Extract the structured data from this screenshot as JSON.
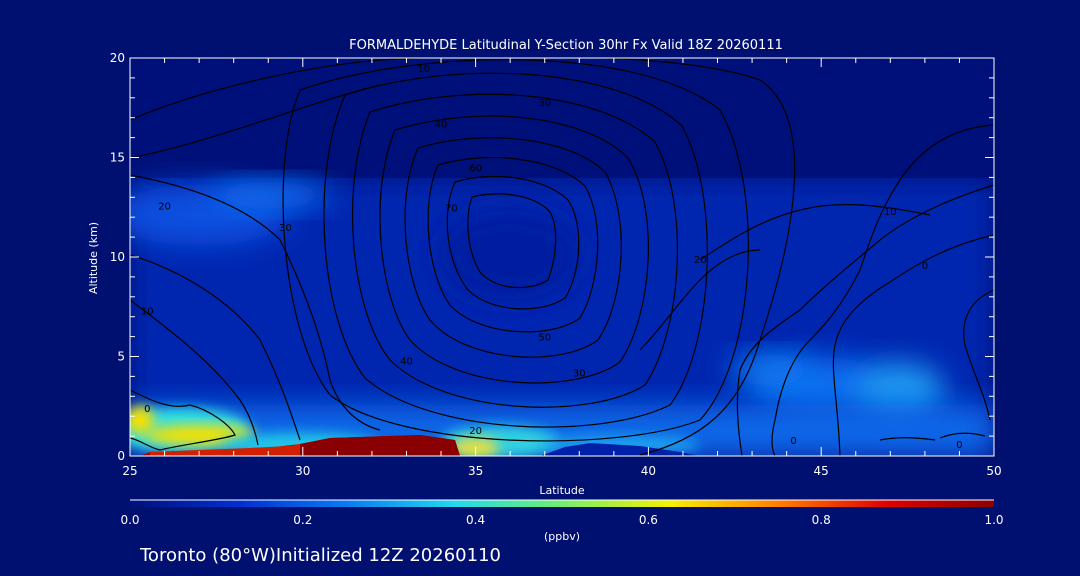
{
  "chart_data": {
    "type": "heatmap",
    "title": "FORMALDEHYDE Latitudinal Y-Section 30hr  Fx Valid 18Z 20260111",
    "xlabel": "Latitude",
    "ylabel": "Altitude (km)",
    "xlim": [
      25,
      50
    ],
    "ylim": [
      0,
      20
    ],
    "x_ticks": [
      25,
      30,
      35,
      40,
      45,
      50
    ],
    "y_ticks": [
      0,
      5,
      10,
      15,
      20
    ],
    "colorbar": {
      "label": "(ppbv)",
      "range": [
        0.0,
        1.0
      ],
      "ticks": [
        "0.0",
        "0.2",
        "0.4",
        "0.6",
        "0.8",
        "1.0"
      ],
      "colors": [
        "#00107a",
        "#0030d0",
        "#0a7af0",
        "#20d8f0",
        "#70f070",
        "#f8f000",
        "#ff8000",
        "#e00000",
        "#8a0000"
      ]
    },
    "field": [
      {
        "lat": 32.5,
        "alt": 0.5,
        "value": 1.0
      },
      {
        "lat": 26.5,
        "alt": 1.0,
        "value": 0.7
      },
      {
        "lat": 25.5,
        "alt": 2.0,
        "value": 0.55
      },
      {
        "lat": 29.0,
        "alt": 1.4,
        "value": 0.35
      },
      {
        "lat": 36.5,
        "alt": 1.0,
        "value": 0.4
      },
      {
        "lat": 28.0,
        "alt": 12.5,
        "value": 0.22
      },
      {
        "lat": 36.0,
        "alt": 10.5,
        "value": 0.08
      },
      {
        "lat": 44.0,
        "alt": 3.5,
        "value": 0.3
      },
      {
        "lat": 47.5,
        "alt": 3.0,
        "value": 0.26
      },
      {
        "lat": 45.0,
        "alt": 7.5,
        "value": 0.15
      }
    ],
    "contour_labels": [
      {
        "text": "10",
        "lat": 33.5,
        "alt": 19.5
      },
      {
        "text": "30",
        "lat": 37.0,
        "alt": 17.8
      },
      {
        "text": "40",
        "lat": 34.0,
        "alt": 16.7
      },
      {
        "text": "60",
        "lat": 35.0,
        "alt": 14.5
      },
      {
        "text": "70",
        "lat": 34.3,
        "alt": 12.5
      },
      {
        "text": "20",
        "lat": 26.0,
        "alt": 12.6
      },
      {
        "text": "30",
        "lat": 29.5,
        "alt": 11.5
      },
      {
        "text": "10",
        "lat": 25.5,
        "alt": 7.3
      },
      {
        "text": "40",
        "lat": 33.0,
        "alt": 4.8
      },
      {
        "text": "50",
        "lat": 37.0,
        "alt": 6.0
      },
      {
        "text": "30",
        "lat": 38.0,
        "alt": 4.2
      },
      {
        "text": "20",
        "lat": 35.0,
        "alt": 1.3
      },
      {
        "text": "0",
        "lat": 25.5,
        "alt": 2.4
      },
      {
        "text": "10",
        "lat": 47.0,
        "alt": 12.3
      },
      {
        "text": "20",
        "lat": 41.5,
        "alt": 9.9
      },
      {
        "text": "0",
        "lat": 48.0,
        "alt": 9.6
      },
      {
        "text": "0",
        "lat": 49.0,
        "alt": 0.6
      },
      {
        "text": "0",
        "lat": 44.2,
        "alt": 0.8
      }
    ]
  },
  "footer": {
    "location": "Toronto (80°W)Initialized 12Z 20260110"
  }
}
